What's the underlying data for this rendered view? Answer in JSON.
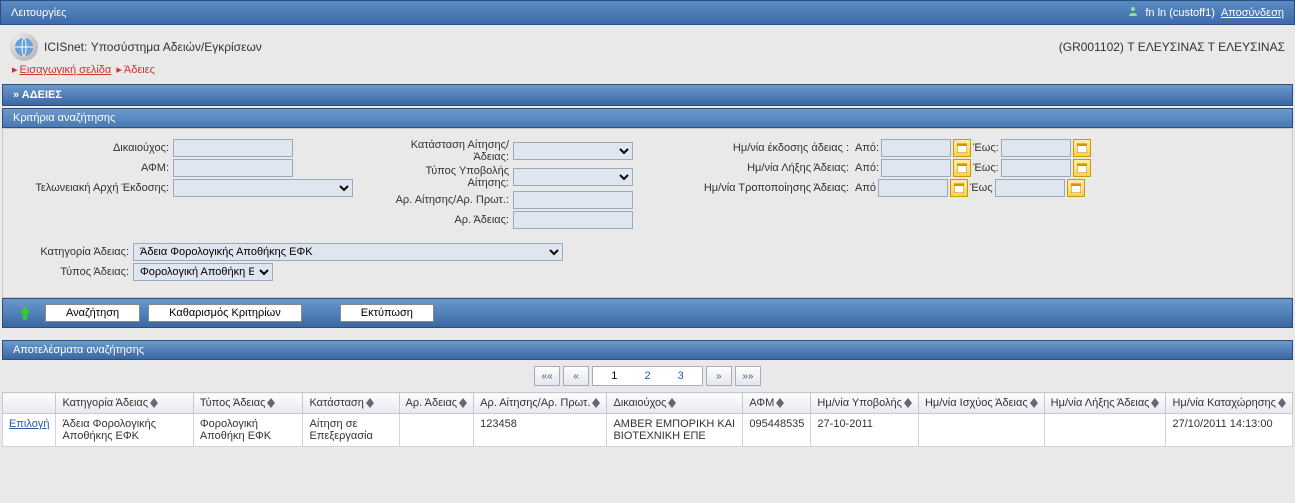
{
  "topbar": {
    "left": "Λειτουργίες",
    "user": "fn ln (custoff1)",
    "logout": "Αποσύνδεση"
  },
  "subheader": {
    "title": "ICISnet: Υποσύστημα Αδειών/Εγκρίσεων",
    "org": "(GR001102) Τ ΕΛΕΥΣΙΝΑΣ Τ ΕΛΕΥΣΙΝΑΣ"
  },
  "breadcrumb": {
    "home": "Εισαγωγική σελίδα",
    "current": "Άδειες"
  },
  "section_title": "» ΑΔΕΙΕΣ",
  "criteria_title": "Κριτήρια αναζήτησης",
  "labels": {
    "beneficiary": "Δικαιούχος:",
    "afm": "ΑΦΜ:",
    "customs": "Τελωνειακή Αρχή Έκδοσης:",
    "status": "Κατάσταση Αίτησης/Άδειας:",
    "subtype": "Τύπος Υποβολής Αίτησης:",
    "appno": "Αρ. Αίτησης/Αρ. Πρωτ.:",
    "licno": "Αρ. Άδειας:",
    "issue_date": "Ημ/νία έκδοσης άδειας :",
    "expiry_date": "Ημ/νία Λήξης Άδειας:",
    "amend_date": "Ημ/νία Τροποποίησης Άδειας:",
    "from": "Από:",
    "to": "Έως:",
    "from2": "Από",
    "to2": "Έως",
    "category": "Κατηγορία Άδειας:",
    "lictype": "Τύπος Άδειας:"
  },
  "values": {
    "category": "Άδεια Φορολογικής Αποθήκης ΕΦΚ",
    "lictype": "Φορολογική Αποθήκη ΕΦΚ"
  },
  "buttons": {
    "search": "Αναζήτηση",
    "clear": "Καθαρισμός Κριτηρίων",
    "print": "Εκτύπωση"
  },
  "results_title": "Αποτελέσματα αναζήτησης",
  "pager": {
    "first": "««",
    "prev": "«",
    "next": "»",
    "last": "»»",
    "pages": [
      "1",
      "2",
      "3"
    ],
    "current": "1"
  },
  "columns": {
    "sel": "",
    "category": "Κατηγορία Άδειας",
    "type": "Τύπος Άδειας",
    "status": "Κατάσταση",
    "licno": "Αρ. Άδειας",
    "appno": "Αρ. Αίτησης/Αρ. Πρωτ.",
    "beneficiary": "Δικαιούχος",
    "afm": "ΑΦΜ",
    "submit_date": "Ημ/νία Υποβολής",
    "valid_date": "Ημ/νία Ισχύος Άδειας",
    "expiry_date": "Ημ/νία Λήξης Άδειας",
    "reg_date": "Ημ/νία Καταχώρησης"
  },
  "rows": [
    {
      "select": "Επιλογή",
      "category": "Άδεια Φορολογικής Αποθήκης ΕΦΚ",
      "type": "Φορολογική Αποθήκη ΕΦΚ",
      "status": "Αίτηση σε Επεξεργασία",
      "licno": "",
      "appno": "123458",
      "beneficiary": "AMBER ΕΜΠΟΡΙΚΗ ΚΑΙ ΒΙΟΤΕΧΝΙΚΗ ΕΠΕ",
      "afm": "095448535",
      "submit_date": "27-10-2011",
      "valid_date": "",
      "expiry_date": "",
      "reg_date": "27/10/2011 14:13:00"
    }
  ]
}
